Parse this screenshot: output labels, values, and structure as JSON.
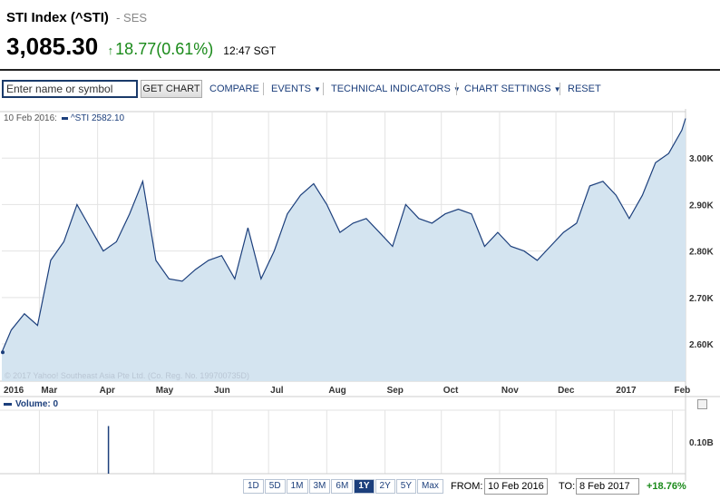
{
  "header": {
    "index_name": "STI Index (^STI)",
    "exchange": "- SES",
    "last_price": "3,085.30",
    "change": "18.77(0.61%)",
    "time": "12:47 SGT",
    "up_color": "#1a8a1a"
  },
  "toolbar": {
    "symbol_placeholder": "Enter name or symbol",
    "get_chart_label": "GET CHART",
    "compare_label": "COMPARE",
    "events_label": "EVENTS",
    "technical_label": "TECHNICAL INDICATORS",
    "settings_label": "CHART SETTINGS",
    "reset_label": "RESET"
  },
  "legend": {
    "date": "10 Feb 2016:",
    "series": "^STI 2582.10"
  },
  "copyright": "© 2017 Yahoo! Southeast Asia Pte Ltd. (Co. Reg. No. 199700735D)",
  "volume_label": "Volume: 0",
  "range": {
    "buttons": [
      "1D",
      "5D",
      "1M",
      "3M",
      "6M",
      "1Y",
      "2Y",
      "5Y",
      "Max"
    ],
    "active": "1Y",
    "from_label": "FROM:",
    "from_value": "10 Feb 2016",
    "to_label": "TO:",
    "to_value": "8 Feb 2017",
    "change": "+18.76%"
  },
  "chart_data": [
    {
      "type": "area",
      "series": [
        {
          "name": "^STI",
          "x": [
            "2016-02-10",
            "2016-02-15",
            "2016-02-22",
            "2016-02-29",
            "2016-03-07",
            "2016-03-14",
            "2016-03-21",
            "2016-03-28",
            "2016-04-04",
            "2016-04-11",
            "2016-04-18",
            "2016-04-25",
            "2016-05-02",
            "2016-05-09",
            "2016-05-16",
            "2016-05-23",
            "2016-05-30",
            "2016-06-06",
            "2016-06-13",
            "2016-06-20",
            "2016-06-27",
            "2016-07-04",
            "2016-07-11",
            "2016-07-18",
            "2016-07-25",
            "2016-08-01",
            "2016-08-08",
            "2016-08-15",
            "2016-08-22",
            "2016-08-29",
            "2016-09-05",
            "2016-09-12",
            "2016-09-19",
            "2016-09-26",
            "2016-10-03",
            "2016-10-10",
            "2016-10-17",
            "2016-10-24",
            "2016-10-31",
            "2016-11-07",
            "2016-11-14",
            "2016-11-21",
            "2016-11-28",
            "2016-12-05",
            "2016-12-12",
            "2016-12-19",
            "2016-12-26",
            "2017-01-02",
            "2017-01-09",
            "2017-01-16",
            "2017-01-23",
            "2017-01-30",
            "2017-02-06",
            "2017-02-08"
          ],
          "values": [
            2582.1,
            2630,
            2665,
            2640,
            2780,
            2820,
            2900,
            2850,
            2800,
            2820,
            2880,
            2950,
            2780,
            2740,
            2735,
            2760,
            2780,
            2790,
            2740,
            2850,
            2740,
            2800,
            2880,
            2920,
            2945,
            2900,
            2840,
            2860,
            2870,
            2840,
            2810,
            2900,
            2870,
            2860,
            2880,
            2890,
            2880,
            2810,
            2840,
            2810,
            2800,
            2780,
            2810,
            2840,
            2860,
            2940,
            2950,
            2920,
            2870,
            2920,
            2990,
            3010,
            3060,
            3085.3
          ]
        }
      ],
      "xlabel": "",
      "ylabel": "",
      "x_ticks": [
        "2016",
        "Mar",
        "Apr",
        "May",
        "Jun",
        "Jul",
        "Aug",
        "Sep",
        "Oct",
        "Nov",
        "Dec",
        "2017",
        "Feb"
      ],
      "y_ticks": [
        "2.60K",
        "2.70K",
        "2.80K",
        "2.90K",
        "3.00K"
      ],
      "ylim": [
        2520,
        3100
      ],
      "grid": true,
      "line_color": "#1c3f7c",
      "fill_color": "#d4e4f0"
    },
    {
      "type": "bar",
      "series": [
        {
          "name": "Volume",
          "x": [
            "2016-04-04"
          ],
          "values": [
            0.15
          ]
        }
      ],
      "y_ticks": [
        "0.10B"
      ],
      "ylim": [
        0,
        0.2
      ],
      "bar_color": "#1c3f7c"
    }
  ]
}
